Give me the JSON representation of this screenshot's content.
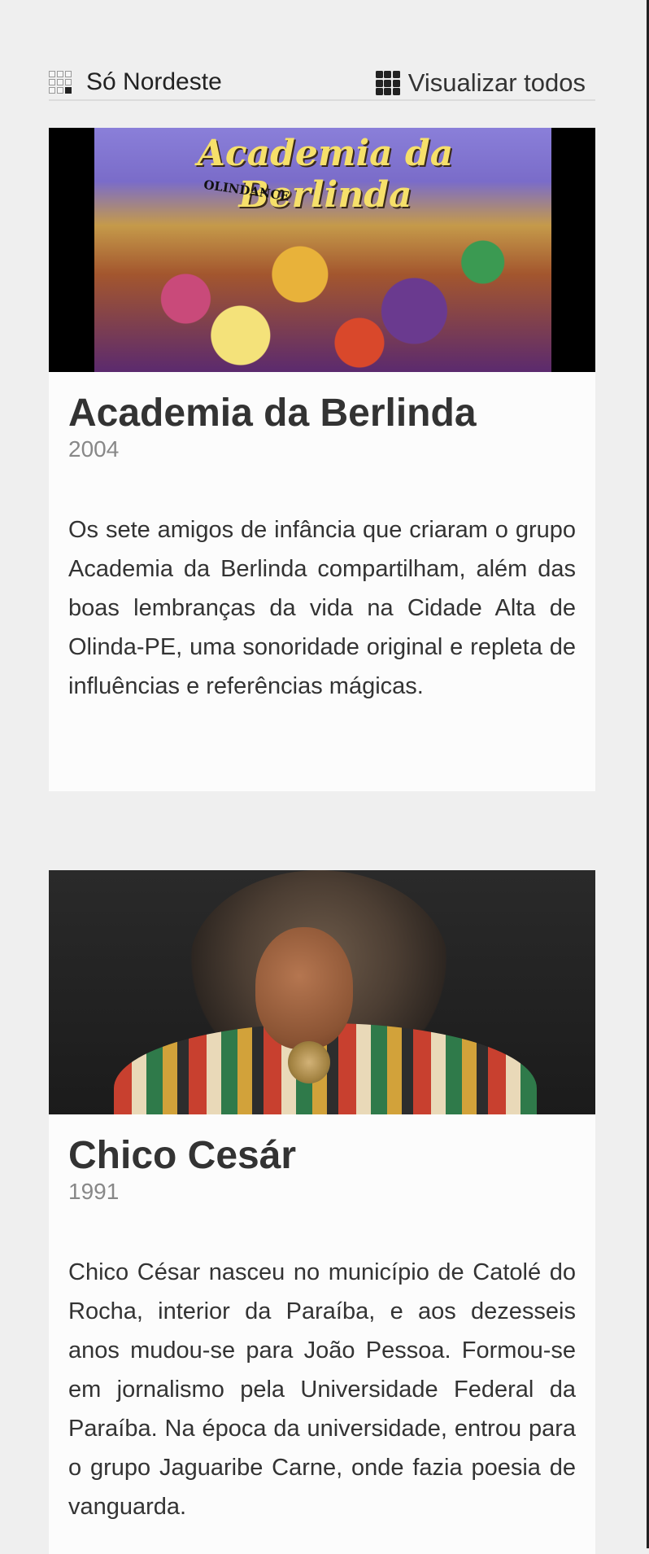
{
  "header": {
    "section_title": "Só Nordeste",
    "view_all_label": "Visualizar todos"
  },
  "cards": [
    {
      "title": "Academia da Berlinda",
      "year": "2004",
      "description": "Os sete amigos de infância que criaram o grupo Academia da Berlinda compartilham, além das boas lembranças da vida na Cidade Alta de Olinda-PE, uma sonoridade original e repleta de influências e referências mágicas.",
      "image_text": "Academia da Berlinda",
      "image_subtext": "OLINDANCE"
    },
    {
      "title": "Chico Cesár",
      "year": "1991",
      "description": "Chico César nasceu no município de Catolé do Rocha, interior da Paraíba, e aos dezesseis anos mudou-se para João Pessoa. Formou-se em jornalismo pela Universidade Federal da Paraíba. Na época da universidade, entrou para o grupo Jaguaribe Carne, onde fazia poesia de vanguarda."
    }
  ],
  "icons": {
    "section_icon": "grid-outline-icon",
    "view_all_icon": "grid-solid-icon"
  }
}
